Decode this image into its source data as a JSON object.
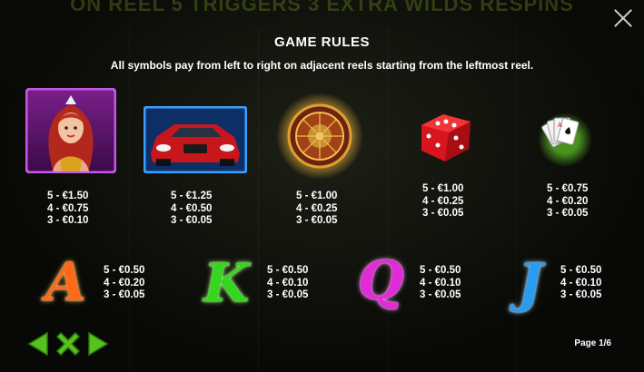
{
  "banner": "ON REEL 5 TRIGGERS 3 EXTRA WILDS RESPINS",
  "title": "GAME RULES",
  "subtitle": "All symbols pay from left to right on adjacent reels starting from the leftmost reel.",
  "high_symbols": [
    {
      "icon": "woman-icon",
      "pays": [
        "5 - €1.50",
        "4 - €0.75",
        "3 - €0.10"
      ]
    },
    {
      "icon": "red-car-icon",
      "pays": [
        "5 - €1.25",
        "4 - €0.50",
        "3 - €0.05"
      ]
    },
    {
      "icon": "roulette-wheel-icon",
      "pays": [
        "5 - €1.00",
        "4 - €0.25",
        "3 - €0.05"
      ]
    },
    {
      "icon": "dice-icon",
      "pays": [
        "5 - €1.00",
        "4 - €0.25",
        "3 - €0.05"
      ]
    },
    {
      "icon": "playing-cards-icon",
      "pays": [
        "5 - €0.75",
        "4 - €0.20",
        "3 - €0.05"
      ]
    }
  ],
  "low_symbols": [
    {
      "letter": "A",
      "icon": "letter-a-icon",
      "pays": [
        "5 - €0.50",
        "4 - €0.20",
        "3 - €0.05"
      ]
    },
    {
      "letter": "K",
      "icon": "letter-k-icon",
      "pays": [
        "5 - €0.50",
        "4 - €0.10",
        "3 - €0.05"
      ]
    },
    {
      "letter": "Q",
      "icon": "letter-q-icon",
      "pays": [
        "5 - €0.50",
        "4 - €0.10",
        "3 - €0.05"
      ]
    },
    {
      "letter": "J",
      "icon": "letter-j-icon",
      "pays": [
        "5 - €0.50",
        "4 - €0.10",
        "3 - €0.05"
      ]
    }
  ],
  "colors": {
    "A": "#ff6a1a",
    "K": "#35d61f",
    "Q": "#e22ad8",
    "J": "#2a9cf0",
    "nav": "#56c21e"
  },
  "page_indicator": "Page 1/6"
}
